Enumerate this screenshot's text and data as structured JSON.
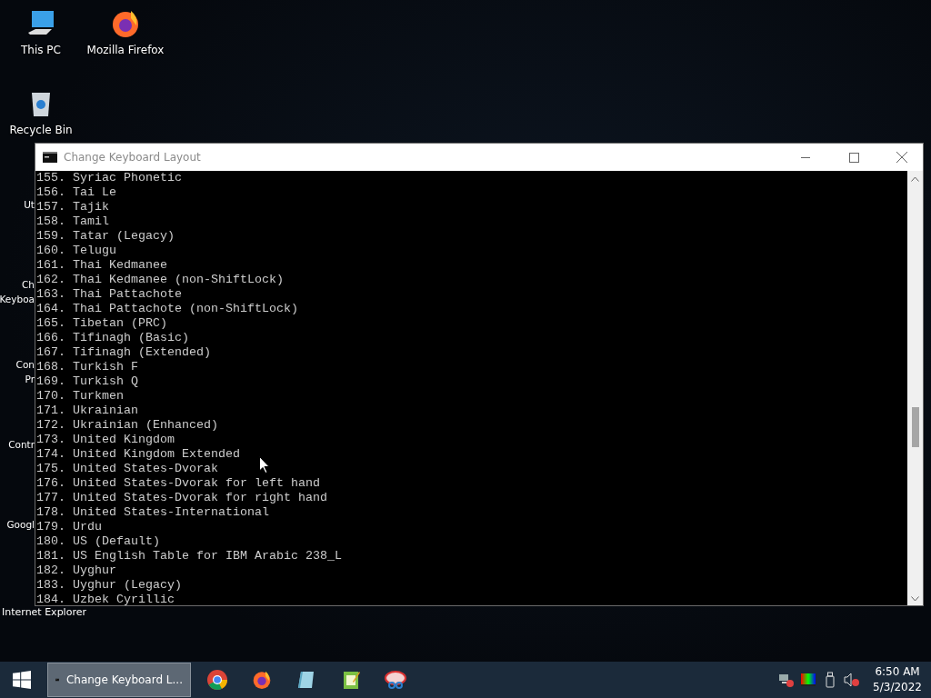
{
  "desktop_icons": [
    {
      "label": "This PC",
      "kind": "pc"
    },
    {
      "label": "Mozilla Firefox",
      "kind": "firefox"
    },
    {
      "label": "Recycle Bin",
      "kind": "bin"
    }
  ],
  "hidden_icon_labels": [
    {
      "lines": [
        "Ut"
      ]
    },
    {
      "lines": [
        "Ch",
        "Keyboa"
      ]
    },
    {
      "lines": [
        "Con",
        "Pr"
      ]
    },
    {
      "lines": [
        "Contr"
      ]
    },
    {
      "lines": [
        "Googl"
      ]
    },
    {
      "lines": [
        "Internet Explorer"
      ]
    }
  ],
  "window": {
    "title": "Change Keyboard Layout"
  },
  "console_lines": [
    "155. Syriac Phonetic",
    "156. Tai Le",
    "157. Tajik",
    "158. Tamil",
    "159. Tatar (Legacy)",
    "160. Telugu",
    "161. Thai Kedmanee",
    "162. Thai Kedmanee (non-ShiftLock)",
    "163. Thai Pattachote",
    "164. Thai Pattachote (non-ShiftLock)",
    "165. Tibetan (PRC)",
    "166. Tifinagh (Basic)",
    "167. Tifinagh (Extended)",
    "168. Turkish F",
    "169. Turkish Q",
    "170. Turkmen",
    "171. Ukrainian",
    "172. Ukrainian (Enhanced)",
    "173. United Kingdom",
    "174. United Kingdom Extended",
    "175. United States-Dvorak",
    "176. United States-Dvorak for left hand",
    "177. United States-Dvorak for right hand",
    "178. United States-International",
    "179. Urdu",
    "180. US (Default)",
    "181. US English Table for IBM Arabic 238_L",
    "182. Uyghur",
    "183. Uyghur (Legacy)",
    "184. Uzbek Cyrillic"
  ],
  "taskbar": {
    "active_task": "Change Keyboard L...",
    "pinned": [
      {
        "kind": "chrome"
      },
      {
        "kind": "firefox"
      },
      {
        "kind": "notes"
      },
      {
        "kind": "editor"
      },
      {
        "kind": "snip"
      }
    ],
    "time": "6:50 AM",
    "date": "5/3/2022"
  }
}
